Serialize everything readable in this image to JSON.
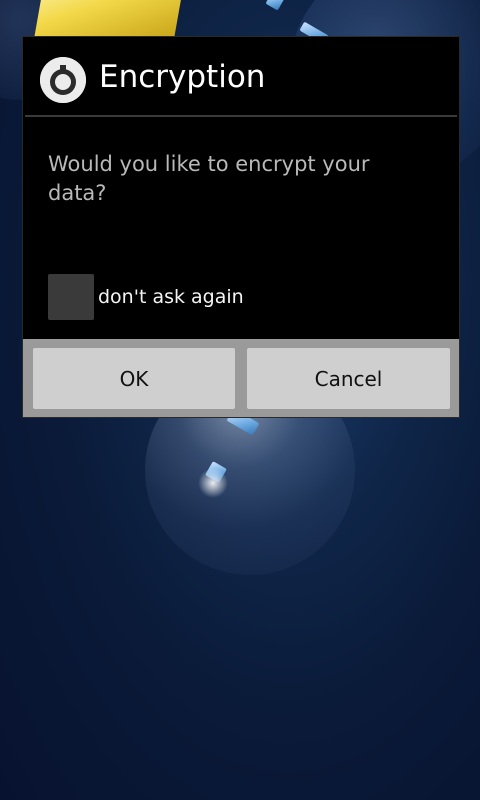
{
  "dialog": {
    "title": "Encryption",
    "icon": "settings-gear-icon",
    "message": "Would you like to encrypt your data?",
    "checkbox_label": "don't ask again",
    "checkbox_checked": false,
    "ok_label": "OK",
    "cancel_label": "Cancel"
  },
  "colors": {
    "dialog_background": "#000000",
    "button_bar": "#9a9a9a",
    "button": "#cfcfcf",
    "message_text": "#b9b9b9"
  }
}
